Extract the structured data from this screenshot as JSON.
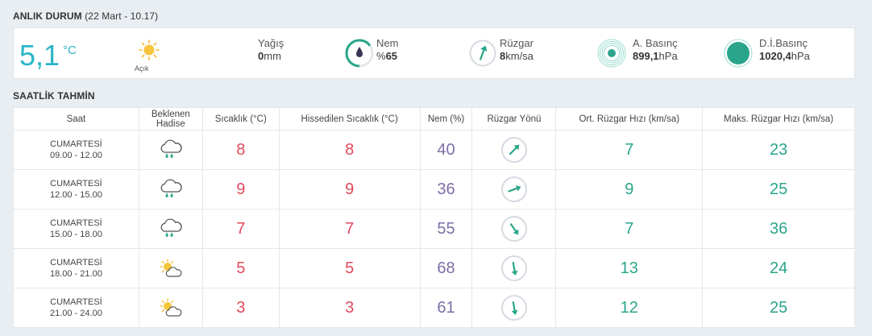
{
  "current": {
    "title": "ANLIK DURUM",
    "subtitle": "(22 Mart - 10.17)",
    "temperature": "5,1",
    "temp_unit": "°C",
    "condition_icon": "sun-icon",
    "condition": "Açık",
    "precip_label": "Yağış",
    "precip_value": "0",
    "precip_unit": "mm",
    "humidity_label": "Nem",
    "humidity_prefix": "%",
    "humidity_value": "65",
    "humidity_level": 65,
    "wind_label": "Rüzgar",
    "wind_value": "8",
    "wind_unit": "km/sa",
    "wind_direction_deg": 20,
    "pressure_label": "A. Basınç",
    "pressure_value": "899,1",
    "pressure_unit": "hPa",
    "sea_pressure_label": "D.İ.Basınç",
    "sea_pressure_value": "1020,4",
    "sea_pressure_unit": "hPa"
  },
  "hourly": {
    "title": "SAATLİK TAHMİN",
    "headers": {
      "saat": "Saat",
      "hadise_1": "Beklenen",
      "hadise_2": "Hadise",
      "sicaklik": "Sıcaklık (°C)",
      "hissedilen": "Hissedilen Sıcaklık (°C)",
      "nem": "Nem (%)",
      "yon": "Rüzgar Yönü",
      "ort": "Ort. Rüzgar Hızı (km/sa)",
      "maks": "Maks. Rüzgar Hızı (km/sa)"
    },
    "rows": [
      {
        "day": "CUMARTESİ",
        "time": "09.00 - 12.00",
        "icon": "rain-cloud-icon",
        "temp": "8",
        "feels": "8",
        "humidity": "40",
        "wind_deg": 45,
        "avg": "7",
        "max": "23"
      },
      {
        "day": "CUMARTESİ",
        "time": "12.00 - 15.00",
        "icon": "rain-cloud-icon",
        "temp": "9",
        "feels": "9",
        "humidity": "36",
        "wind_deg": 70,
        "avg": "9",
        "max": "25"
      },
      {
        "day": "CUMARTESİ",
        "time": "15.00 - 18.00",
        "icon": "rain-cloud-icon",
        "temp": "7",
        "feels": "7",
        "humidity": "55",
        "wind_deg": 145,
        "avg": "7",
        "max": "36"
      },
      {
        "day": "CUMARTESİ",
        "time": "18.00 - 21.00",
        "icon": "partly-cloudy-icon",
        "temp": "5",
        "feels": "5",
        "humidity": "68",
        "wind_deg": 170,
        "avg": "13",
        "max": "24"
      },
      {
        "day": "CUMARTESİ",
        "time": "21.00 - 24.00",
        "icon": "partly-cloudy-icon",
        "temp": "3",
        "feels": "3",
        "humidity": "61",
        "wind_deg": 170,
        "avg": "12",
        "max": "25"
      }
    ]
  },
  "colors": {
    "accent": "#2bb5c8",
    "green": "#2aa58a",
    "temp_red": "#e04a5c",
    "humidity_purple": "#7e6ea6"
  }
}
